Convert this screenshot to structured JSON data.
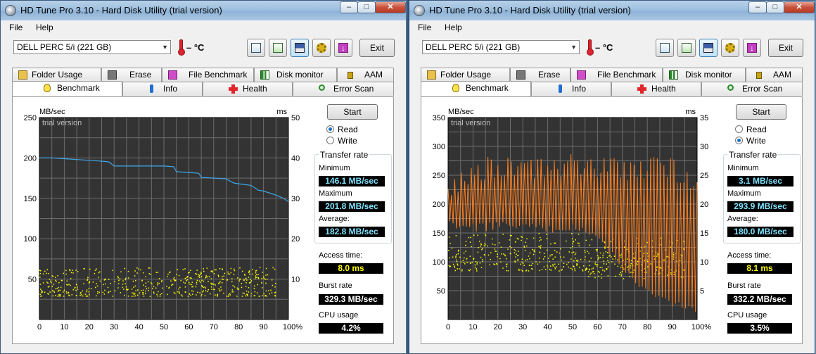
{
  "windows": [
    {
      "title": "HD Tune Pro 3.10 - Hard Disk Utility (trial version)",
      "menu": [
        "File",
        "Help"
      ],
      "drive": "DELL    PERC 5/i (221 GB)",
      "temperature": "– °C",
      "exit_label": "Exit",
      "tabs_top": [
        "Folder Usage",
        "Erase",
        "File Benchmark",
        "Disk monitor",
        "AAM"
      ],
      "tabs_bottom": [
        "Benchmark",
        "Info",
        "Health",
        "Error Scan"
      ],
      "active_tab": "Benchmark",
      "start_label": "Start",
      "read_label": "Read",
      "write_label": "Write",
      "selected_mode": "Read",
      "transfer_rate_title": "Transfer rate",
      "minimum_label": "Minimum",
      "minimum_value": "146.1 MB/sec",
      "maximum_label": "Maximum",
      "maximum_value": "201.8 MB/sec",
      "average_label": "Average:",
      "average_value": "182.8 MB/sec",
      "access_label": "Access time:",
      "access_value": "8.0 ms",
      "burst_label": "Burst rate",
      "burst_value": "329.3 MB/sec",
      "cpu_label": "CPU usage",
      "cpu_value": "4.2%",
      "chart_data": {
        "type": "line",
        "left_unit": "MB/sec",
        "right_unit": "ms",
        "watermark": "trial version",
        "ylim": [
          0,
          250
        ],
        "y_ticks": [
          50,
          100,
          150,
          200,
          250
        ],
        "y2lim": [
          0,
          50
        ],
        "y2_ticks": [
          10,
          20,
          30,
          40,
          50
        ],
        "x_ticks": [
          "0",
          "10",
          "20",
          "30",
          "40",
          "50",
          "60",
          "70",
          "80",
          "90",
          "100%"
        ],
        "grid": true,
        "series": [
          {
            "color": "#3ea7e8",
            "x": [
              0,
              5,
              10,
              15,
              20,
              25,
              28,
              30,
              40,
              50,
              54,
              55,
              60,
              64,
              65,
              70,
              75,
              78,
              80,
              85,
              88,
              90,
              95,
              98,
              100
            ],
            "y": [
              200,
              200,
              199,
              198,
              197,
              196,
              195,
              190,
              190,
              190,
              189,
              183,
              182,
              181,
              176,
              175,
              174,
              169,
              168,
              166,
              160,
              159,
              154,
              150,
              146
            ]
          }
        ],
        "access_scatter": {
          "color": "#ffff00",
          "band_ms": [
            2,
            13
          ]
        }
      }
    },
    {
      "title": "HD Tune Pro 3.10 - Hard Disk Utility (trial version)",
      "menu": [
        "File",
        "Help"
      ],
      "drive": "DELL    PERC 5/i (221 GB)",
      "temperature": "– °C",
      "exit_label": "Exit",
      "tabs_top": [
        "Folder Usage",
        "Erase",
        "File Benchmark",
        "Disk monitor",
        "AAM"
      ],
      "tabs_bottom": [
        "Benchmark",
        "Info",
        "Health",
        "Error Scan"
      ],
      "active_tab": "Benchmark",
      "start_label": "Start",
      "read_label": "Read",
      "write_label": "Write",
      "selected_mode": "Write",
      "transfer_rate_title": "Transfer rate",
      "minimum_label": "Minimum",
      "minimum_value": "3.1 MB/sec",
      "maximum_label": "Maximum",
      "maximum_value": "293.9 MB/sec",
      "average_label": "Average:",
      "average_value": "180.0 MB/sec",
      "access_label": "Access time:",
      "access_value": "8.1 ms",
      "burst_label": "Burst rate",
      "burst_value": "332.2 MB/sec",
      "cpu_label": "CPU usage",
      "cpu_value": "3.5%",
      "chart_data": {
        "type": "line",
        "left_unit": "MB/sec",
        "right_unit": "ms",
        "watermark": "trial version",
        "ylim": [
          0,
          350
        ],
        "y_ticks": [
          50,
          100,
          150,
          200,
          250,
          300,
          350
        ],
        "y2lim": [
          0,
          35
        ],
        "y2_ticks": [
          5,
          10,
          15,
          20,
          25,
          30,
          35
        ],
        "x_ticks": [
          "0",
          "10",
          "20",
          "30",
          "40",
          "50",
          "60",
          "70",
          "80",
          "90",
          "100%"
        ],
        "grid": true,
        "series": [
          {
            "color": "#ff7f1e",
            "oscillation": true,
            "x": [
              0,
              10,
              20,
              30,
              40,
              50,
              60,
              65,
              70,
              75,
              80,
              85,
              90,
              95,
              100
            ],
            "y_high": [
              240,
              280,
              285,
              285,
              285,
              290,
              285,
              280,
              280,
              275,
              280,
              285,
              280,
              270,
              250
            ],
            "y_low": [
              160,
              150,
              155,
              155,
              150,
              150,
              140,
              110,
              80,
              60,
              40,
              30,
              20,
              10,
              5
            ]
          }
        ],
        "access_scatter": {
          "color": "#ffff00",
          "band_ms": [
            5,
            15
          ]
        }
      }
    }
  ]
}
